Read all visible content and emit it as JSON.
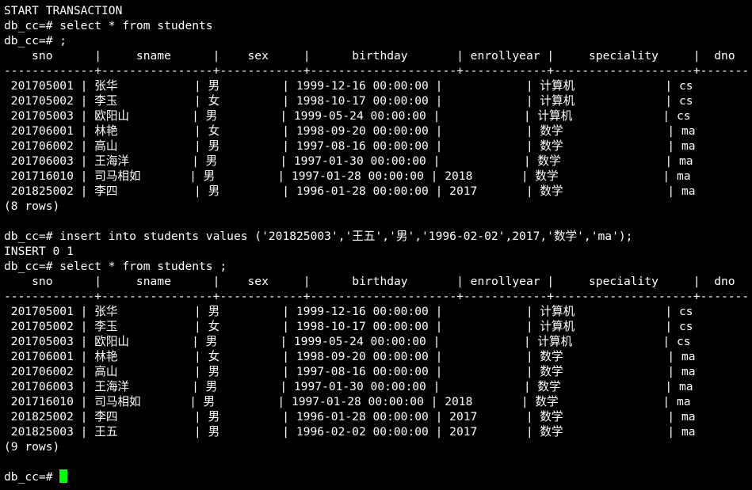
{
  "terminal": {
    "prompt": "db_cc=# ",
    "cursor_color": "#00ff00",
    "lines": [
      "START TRANSACTION",
      "db_cc=# select * from students",
      "db_cc=# ;",
      "    sno      |     sname      |    sex     |      birthday       | enrollyear |     speciality     |  dno",
      "-------------+----------------+------------+---------------------+------------+--------------------+-------",
      " 201705001 | 张华           | 男         | 1999-12-16 00:00:00 |            | 计算机             | cs",
      " 201705002 | 李玉           | 女         | 1998-10-17 00:00:00 |            | 计算机             | cs",
      " 201705003 | 欧阳山         | 男         | 1999-05-24 00:00:00 |            | 计算机             | cs",
      " 201706001 | 林艳           | 女         | 1998-09-20 00:00:00 |            | 数学               | ma",
      " 201706002 | 高山           | 男         | 1997-08-16 00:00:00 |            | 数学               | ma",
      " 201706003 | 王海洋         | 男         | 1997-01-30 00:00:00 |            | 数学               | ma",
      " 201716010 | 司马相如       | 男         | 1997-01-28 00:00:00 | 2018       | 数学               | ma",
      " 201825002 | 李四           | 男         | 1996-01-28 00:00:00 | 2017       | 数学               | ma",
      "(8 rows)",
      "",
      "db_cc=# insert into students values ('201825003','王五','男','1996-02-02',2017,'数学','ma');",
      "INSERT 0 1",
      "db_cc=# select * from students ;",
      "    sno      |     sname      |    sex     |      birthday       | enrollyear |     speciality     |  dno",
      "-------------+----------------+------------+---------------------+------------+--------------------+-------",
      " 201705001 | 张华           | 男         | 1999-12-16 00:00:00 |            | 计算机             | cs",
      " 201705002 | 李玉           | 女         | 1998-10-17 00:00:00 |            | 计算机             | cs",
      " 201705003 | 欧阳山         | 男         | 1999-05-24 00:00:00 |            | 计算机             | cs",
      " 201706001 | 林艳           | 女         | 1998-09-20 00:00:00 |            | 数学               | ma",
      " 201706002 | 高山           | 男         | 1997-08-16 00:00:00 |            | 数学               | ma",
      " 201706003 | 王海洋         | 男         | 1997-01-30 00:00:00 |            | 数学               | ma",
      " 201716010 | 司马相如       | 男         | 1997-01-28 00:00:00 | 2018       | 数学               | ma",
      " 201825002 | 李四           | 男         | 1996-01-28 00:00:00 | 2017       | 数学               | ma",
      " 201825003 | 王五           | 男         | 1996-02-02 00:00:00 | 2017       | 数学               | ma",
      "(9 rows)",
      ""
    ]
  }
}
